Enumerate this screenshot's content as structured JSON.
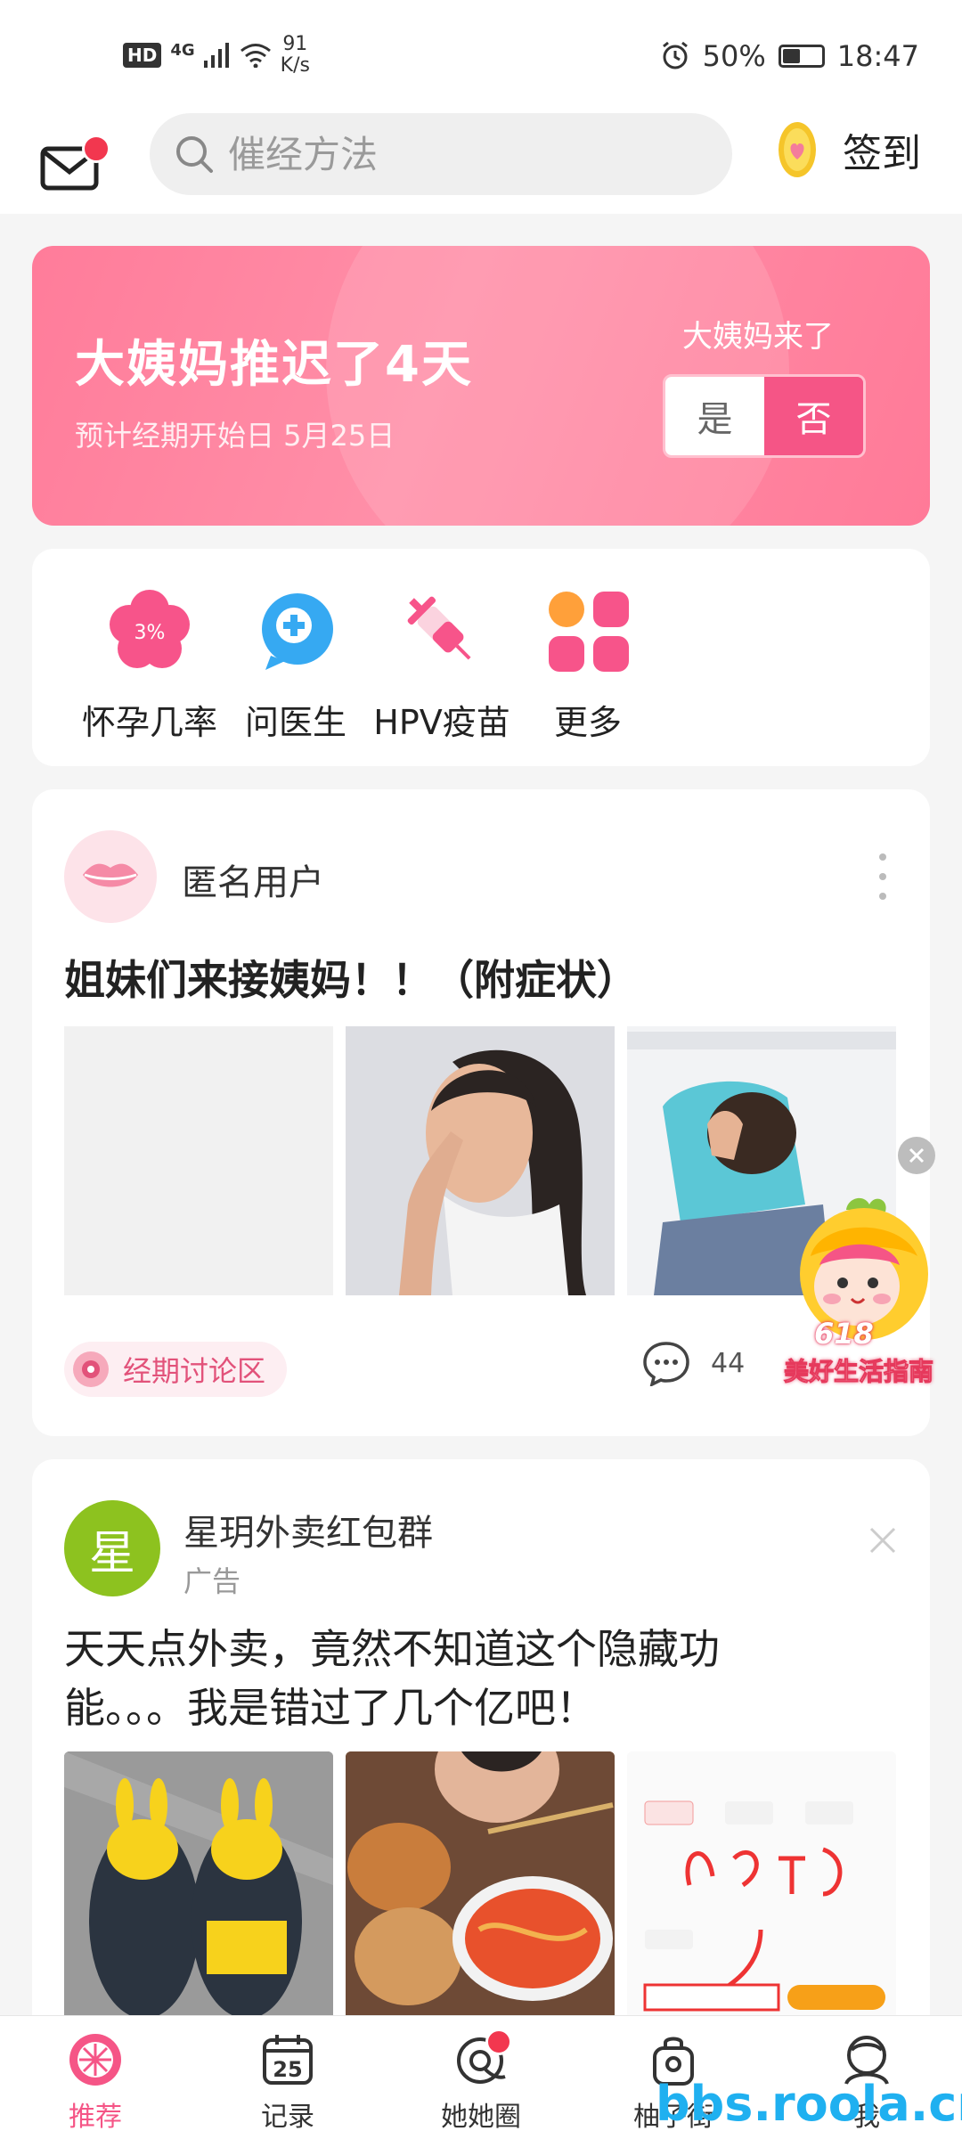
{
  "status_bar": {
    "hd": "HD",
    "network": "4G",
    "speed_value": "91",
    "speed_unit": "K/s",
    "battery": "50%",
    "battery_level": 0.5,
    "time": "18:47"
  },
  "header": {
    "search_placeholder": "催经方法",
    "checkin_label": "签到"
  },
  "period_card": {
    "title": "大姨妈推迟了4天",
    "subtitle": "预计经期开始日 5月25日",
    "question": "大姨妈来了",
    "yes_label": "是",
    "no_label": "否"
  },
  "tools": [
    {
      "label": "怀孕几率",
      "icon_text": "3%",
      "icon": "flower-icon"
    },
    {
      "label": "问医生",
      "icon": "doctor-chat-icon"
    },
    {
      "label": "HPV疫苗",
      "icon": "syringe-icon"
    },
    {
      "label": "更多",
      "icon": "grid-icon"
    }
  ],
  "post": {
    "author": "匿名用户",
    "title": "姐妹们来接姨妈！！（附症状）",
    "topic": "经期讨论区",
    "comment_count": "44"
  },
  "promo": {
    "label": "美好生活指南",
    "badge": "618"
  },
  "ad": {
    "avatar_char": "星",
    "name": "星玥外卖红包群",
    "tag": "广告",
    "text": "天天点外卖，竟然不知道这个隐藏功能。。。我是错过了几个亿吧！"
  },
  "bottom_nav": [
    {
      "label": "推荐",
      "active": true
    },
    {
      "label": "记录",
      "icon_text": "25"
    },
    {
      "label": "她她圈"
    },
    {
      "label": "柚子街"
    },
    {
      "label": "我"
    }
  ],
  "watermark": "bbs.roola.cn",
  "colors": {
    "accent": "#f55586",
    "card_gradient_start": "#ff7c9a",
    "ad_avatar": "#8dc21f"
  }
}
